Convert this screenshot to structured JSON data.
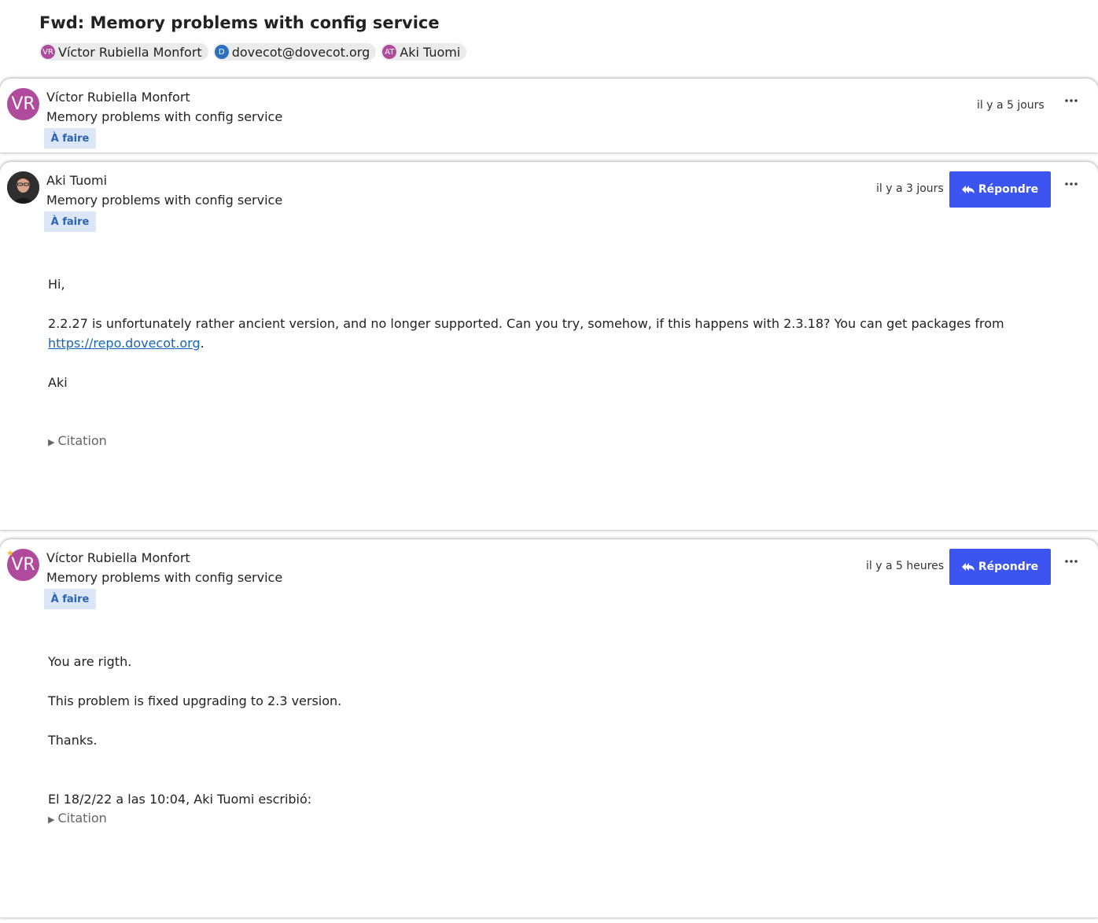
{
  "thread": {
    "title": "Fwd: Memory problems with config service",
    "participants": [
      {
        "initials": "VR",
        "name": "Víctor Rubiella Monfort",
        "color": "#b04a9c"
      },
      {
        "initials": "D",
        "name": "dovecot@dovecot.org",
        "color": "#2f6fc0"
      },
      {
        "initials": "AT",
        "name": "Aki Tuomi",
        "color": "#b04a9c"
      }
    ]
  },
  "messages": [
    {
      "sender": "Víctor Rubiella Monfort",
      "initials": "VR",
      "subject": "Memory problems with config service",
      "tag": "À faire",
      "time": "il y a 5 jours"
    },
    {
      "sender": "Aki Tuomi",
      "initials": "",
      "subject": "Memory problems with config service",
      "tag": "À faire",
      "time": "il y a 3 jours",
      "reply_label": "Répondre",
      "body": {
        "greeting": "Hi,",
        "line1": "2.2.27 is unfortunately rather ancient version, and no longer supported. Can you try, somehow, if this happens with 2.3.18? You can get packages from",
        "link": "https://repo.dovecot.org",
        "link_suffix": ".",
        "signoff": "Aki"
      },
      "citation": "Citation"
    },
    {
      "sender": "Víctor Rubiella Monfort",
      "initials": "VR",
      "subject": "Memory problems with config service",
      "tag": "À faire",
      "time": "il y a 5 heures",
      "reply_label": "Répondre",
      "body": {
        "line1": "You are rigth.",
        "line2": "This problem is fixed upgrading to 2.3 version.",
        "line3": "Thanks.",
        "quote_header": "El 18/2/22 a las 10:04, Aki Tuomi escribió:"
      },
      "citation": "Citation"
    }
  ],
  "colors": {
    "accent": "#3c54f0",
    "avatar_purple": "#b04a9c",
    "tag_bg": "#dbe7f6",
    "tag_text": "#2a63b5",
    "link": "#1a64b8"
  },
  "icons": {
    "reply": "reply-all-icon",
    "more": "more-horizontal-icon",
    "favorite": "star-icon"
  }
}
